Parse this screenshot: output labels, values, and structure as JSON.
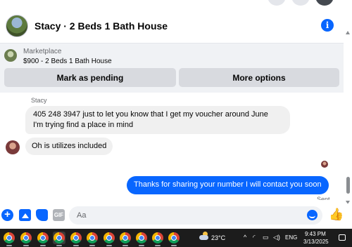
{
  "header": {
    "title": "Stacy · 2 Beds 1 Bath House"
  },
  "marketplace": {
    "label": "Marketplace",
    "listing": "$900 - 2 Beds 1 Bath House",
    "pending_button": "Mark as pending",
    "options_button": "More options"
  },
  "messages": [
    {
      "sender": "Stacy",
      "line1": "405 248 3947 just to let you know that I get my voucher around June",
      "line2": "I'm trying find a place in mind"
    },
    {
      "text": "Oh is utilizes included"
    },
    {
      "text": "Thanks for sharing your number I will contact you soon",
      "status": "Sent"
    }
  ],
  "composer": {
    "placeholder": "Aa",
    "gif_label": "GIF",
    "plus_label": "+"
  },
  "taskbar": {
    "temperature": "23°C",
    "language": "ENG",
    "time": "9:43 PM",
    "date": "3/13/2025",
    "tray_caret": "^",
    "app_count_visible": 11
  },
  "colors": {
    "accent": "#0866ff",
    "bubble_incoming": "#f0f0f0",
    "taskbar": "#1c1c1c"
  }
}
